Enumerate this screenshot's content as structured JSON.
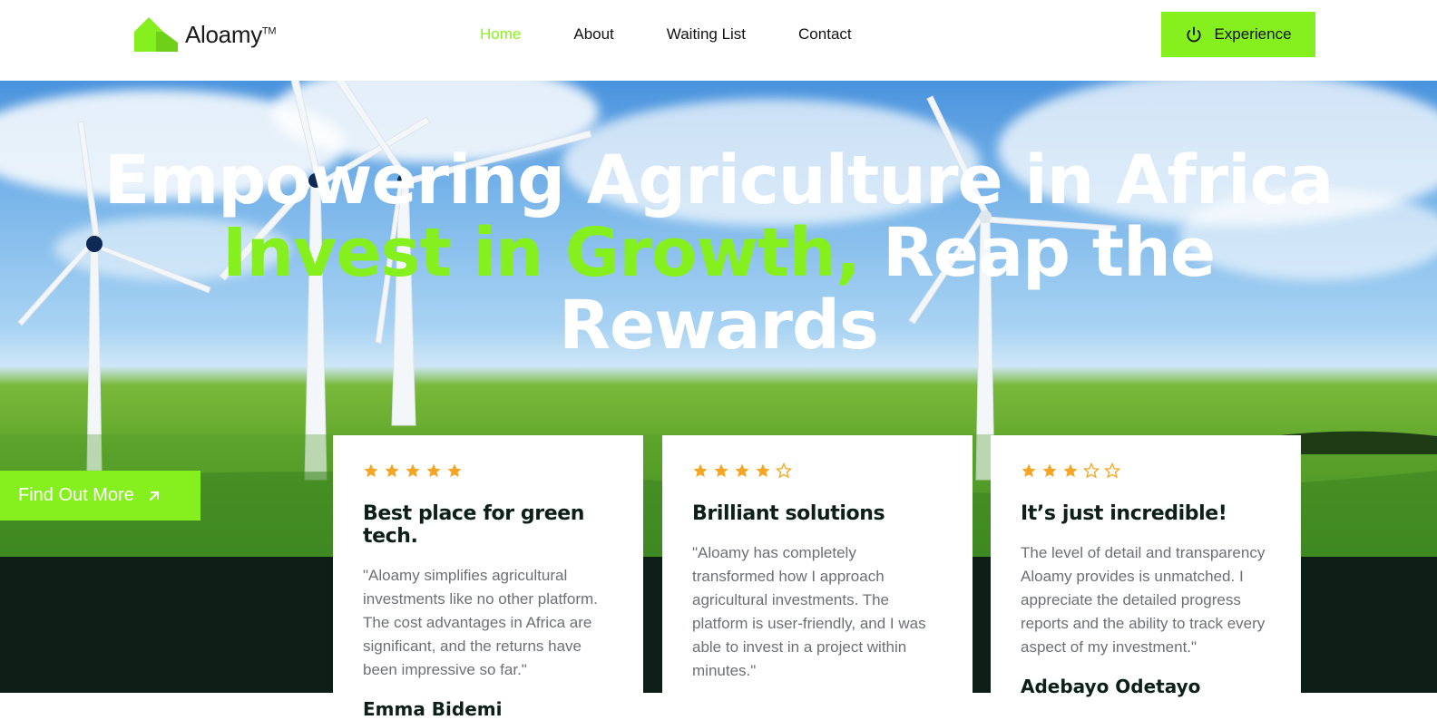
{
  "brand": {
    "name": "Aloamy",
    "tm": "TM",
    "accent": "#86f01e",
    "dark": "#0d1e17"
  },
  "nav": {
    "links": [
      {
        "label": "Home",
        "active": true
      },
      {
        "label": "About",
        "active": false
      },
      {
        "label": "Waiting List",
        "active": false
      },
      {
        "label": "Contact",
        "active": false
      }
    ],
    "cta_label": "Experience",
    "cta_icon": "power-icon"
  },
  "hero": {
    "line1": "Empowering Agriculture in Africa",
    "line2_green": "Invest in Growth,",
    "line2_white": " Reap the",
    "line3": "Rewards",
    "find_more_label": "Find Out More",
    "find_more_icon": "arrow-up-right-icon"
  },
  "testimonials": [
    {
      "rating": 5,
      "title": "Best place for green tech.",
      "quote": "\"Aloamy simplifies agricultural investments like no other platform. The cost advantages in Africa are significant, and the returns have been impressive so far.\"",
      "author": "Emma Bidemi"
    },
    {
      "rating": 4,
      "title": "Brilliant solutions",
      "quote": "\"Aloamy has completely transformed how I approach agricultural investments. The platform is user-friendly, and I was able to invest in a project within minutes.\"",
      "author": ""
    },
    {
      "rating": 3,
      "title": "It’s just incredible!",
      "quote": "The level of detail and transparency Aloamy provides is unmatched. I appreciate the detailed progress reports and the ability to track every aspect of my investment.\"",
      "author": "Adebayo Odetayo"
    }
  ]
}
